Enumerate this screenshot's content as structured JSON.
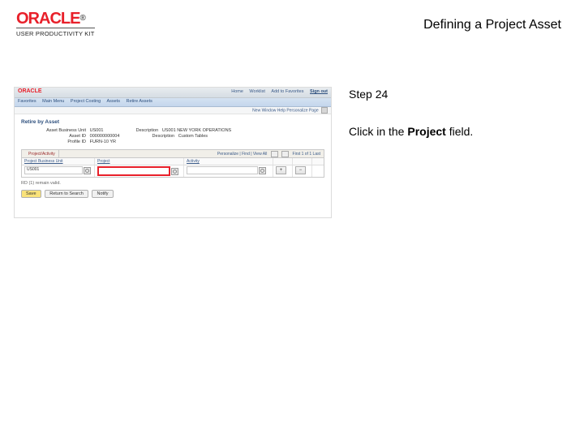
{
  "header": {
    "brand": "ORACLE",
    "brand_tm": "®",
    "brand_sub": "USER PRODUCTIVITY KIT",
    "title": "Defining a Project Asset"
  },
  "instruction": {
    "step_label": "Step 24",
    "text_prefix": "Click in the ",
    "text_bold": "Project",
    "text_suffix": " field."
  },
  "shot": {
    "brand": "ORACLE",
    "top_links": [
      "Home",
      "Worklist",
      "Add to Favorites",
      "Sign out"
    ],
    "nav": [
      "Favorites",
      "Main Menu",
      "Project Costing",
      "Assets",
      "Retire Assets"
    ],
    "subbar_links": "New Window  Help  Personalize Page",
    "page_title": "Retire by Asset",
    "fields": {
      "asset_bu_label": "Asset Business Unit",
      "asset_bu_value": "US001",
      "desc_label": "Description",
      "desc_value": "US001 NEW YORK OPERATIONS",
      "asset_id_label": "Asset ID",
      "asset_id_value": "000000000004",
      "desc2_label": "Description",
      "desc2_value": "Custom Tables",
      "profile_label": "Profile ID",
      "profile_value": "FURN-10 YR"
    },
    "grid": {
      "tab_label": "Project/Activity",
      "personalize": "Personalize | Find | View All",
      "paging": "First  1 of 1  Last",
      "columns": [
        "Project Business Unit",
        "Project",
        "Activity"
      ],
      "row": {
        "pbu": "US001",
        "plus": "+",
        "minus": "−"
      }
    },
    "status": "RD (1) remain valid.",
    "buttons": {
      "save": "Save",
      "return": "Return to Search",
      "notify": "Notify"
    }
  }
}
